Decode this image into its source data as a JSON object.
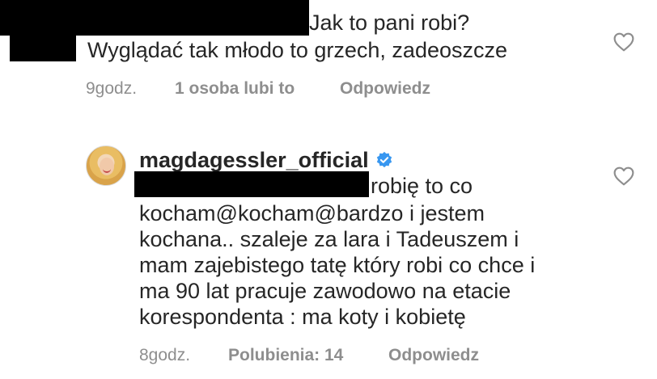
{
  "comments": [
    {
      "text_line1": "Jak to pani robi?",
      "text_line2": "Wyglądać tak młodo to grzech, zadeoszcze",
      "time": "9godz.",
      "likes": "1 osoba lubi to",
      "reply": "Odpowiedz",
      "like_icon": "heart-outline-icon"
    },
    {
      "username": "magdagessler_official",
      "verified_icon": "verified-badge-icon",
      "text_first": "robię to co",
      "text_lines": [
        "kocham@kocham@bardzo i jestem",
        "kochana.. szaleje za lara i Tadeuszem i",
        "mam zajebistego tatę który robi co chce i",
        "ma 90 lat pracuje zawodowo na etacie",
        "korespondenta : ma koty i kobietę"
      ],
      "time": "8godz.",
      "likes": "Polubienia: 14",
      "reply": "Odpowiedz",
      "like_icon": "heart-outline-icon"
    }
  ],
  "colors": {
    "text": "#262626",
    "meta": "#8e8e8e",
    "verified": "#3897f0",
    "redaction": "#000000"
  }
}
